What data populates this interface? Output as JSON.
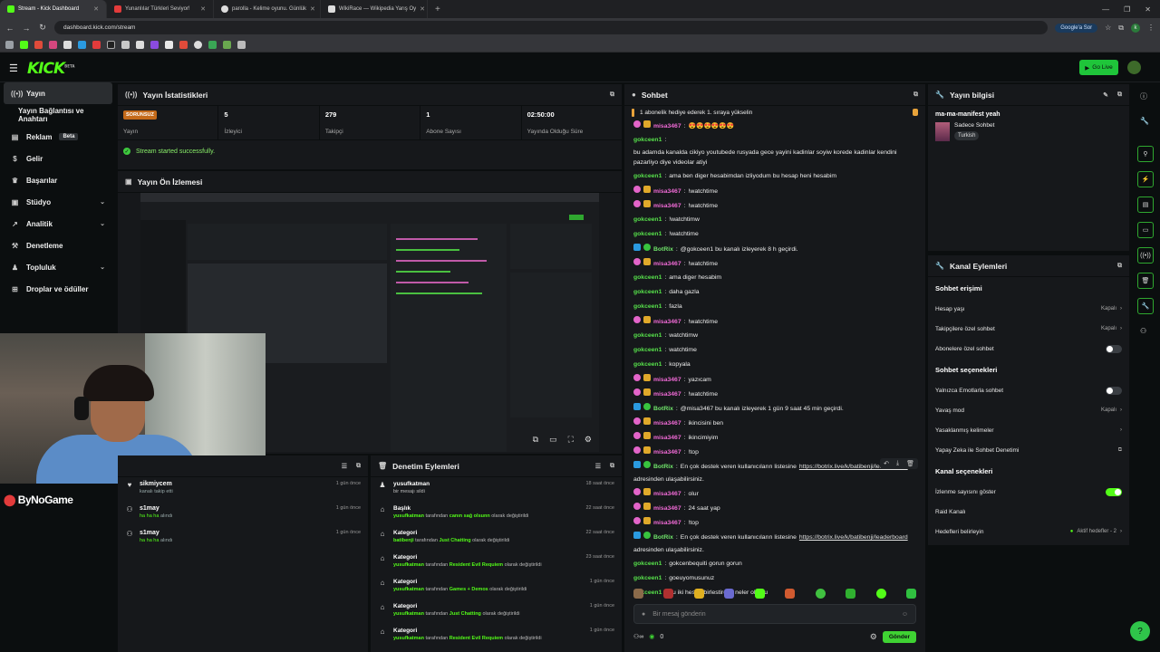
{
  "browser": {
    "tabs": [
      {
        "title": "Stream - Kick Dashboard",
        "color": "#53fc18"
      },
      {
        "title": "Yunanlılar Türkleri Seviyor!",
        "color": "#e23b3b"
      },
      {
        "title": "parolla - Kelime oyunu. Günlük",
        "color": "#dddddd"
      },
      {
        "title": "WikiRace — Wikipedia Yarış Oy",
        "color": "#dddddd"
      }
    ],
    "url": "dashboard.kick.com/stream",
    "google_label": "Google'a Sor",
    "profile_initial": "k"
  },
  "header": {
    "logo": "KICK",
    "logo_sup": "BETA",
    "go_live": "Go Live"
  },
  "sidebar": {
    "items": [
      {
        "label": "Yayın",
        "icon": "((•))",
        "chev": ""
      },
      {
        "label": "Yayın Bağlantısı ve Anahtarı",
        "icon": "",
        "chev": ""
      },
      {
        "label": "Reklam",
        "icon": "▤",
        "chev": "",
        "badge": "Beta"
      },
      {
        "label": "Gelir",
        "icon": "$",
        "chev": ""
      },
      {
        "label": "Başarılar",
        "icon": "♛",
        "chev": ""
      },
      {
        "label": "Stüdyo",
        "icon": "▣",
        "chev": "⌄"
      },
      {
        "label": "Analitik",
        "icon": "↗",
        "chev": "⌄"
      },
      {
        "label": "Denetleme",
        "icon": "⚒",
        "chev": ""
      },
      {
        "label": "Topluluk",
        "icon": "♟",
        "chev": "⌄"
      },
      {
        "label": "Droplar ve ödüller",
        "icon": "⊞",
        "chev": ""
      }
    ]
  },
  "stats": {
    "title": "Yayın İstatistikleri",
    "cells": [
      {
        "value": "SORUNSUZ",
        "label": "Yayın"
      },
      {
        "value": "5",
        "label": "İzleyici"
      },
      {
        "value": "279",
        "label": "Takipçi"
      },
      {
        "value": "1",
        "label": "Abone Sayısı"
      },
      {
        "value": "02:50:00",
        "label": "Yayında Olduğu Süre"
      }
    ],
    "message": "Stream started successfully."
  },
  "preview": {
    "title": "Yayın Ön İzlemesi"
  },
  "overlay": {
    "brand": "ByNoGame"
  },
  "activity": {
    "rows": [
      {
        "name": "sikmiycem",
        "desc": "kanalı takip etti",
        "time": "1 gün önce",
        "icon": "♥"
      },
      {
        "name": "s1may",
        "desc": "ha ha ha",
        "desc2": "alındı",
        "time": "1 gün önce",
        "icon": "⚇"
      },
      {
        "name": "s1may",
        "desc": "ha ha ha",
        "desc2": "alındı",
        "time": "1 gün önce",
        "icon": "⚇"
      }
    ]
  },
  "moderation": {
    "title": "Denetim Eylemleri",
    "rows": [
      {
        "name": "yusufkatman",
        "d1": "bir mesajı sildi",
        "d_user": "",
        "d_mid": "",
        "d_val": "",
        "d_end": "",
        "time": "18 saat önce",
        "icon": "♟"
      },
      {
        "name": "Başlık",
        "d1": "",
        "d_user": "yusufkatman",
        "d_mid": "tarafından",
        "d_val": "canın sağ olsunn",
        "d_end": "olarak değiştirildi",
        "time": "22 saat önce",
        "icon": "⌂"
      },
      {
        "name": "Kategori",
        "d1": "",
        "d_user": "batibenji",
        "d_mid": "tarafından",
        "d_val": "Just Chatting",
        "d_end": "olarak değiştirildi",
        "time": "22 saat önce",
        "icon": "⌂"
      },
      {
        "name": "Kategori",
        "d1": "",
        "d_user": "yusufkatman",
        "d_mid": "tarafından",
        "d_val": "Resident Evil Requiem",
        "d_end": "olarak değiştirildi",
        "time": "23 saat önce",
        "icon": "⌂"
      },
      {
        "name": "Kategori",
        "d1": "",
        "d_user": "yusufkatman",
        "d_mid": "tarafından",
        "d_val": "Games + Demos",
        "d_end": "olarak değiştirildi",
        "time": "1 gün önce",
        "icon": "⌂"
      },
      {
        "name": "Kategori",
        "d1": "",
        "d_user": "yusufkatman",
        "d_mid": "tarafından",
        "d_val": "Just Chatting",
        "d_end": "olarak değiştirildi",
        "time": "1 gün önce",
        "icon": "⌂"
      },
      {
        "name": "Kategori",
        "d1": "",
        "d_user": "yusufkatman",
        "d_mid": "tarafından",
        "d_val": "Resident Evil Requiem",
        "d_end": "olarak değiştirildi",
        "time": "1 gün önce",
        "icon": "⌂"
      }
    ]
  },
  "chat": {
    "title": "Sohbet",
    "pinned": "1 abonelik hediye ederek 1. sıraya yükselin",
    "messages": [
      {
        "user": "misa3467",
        "type": "misa",
        "text": "😍😍😍😍😍😍"
      },
      {
        "user": "gokceen1",
        "type": "gok",
        "text": "bu adamda kanalda cikiyo youtubede rusyada gece yayini kadinlar soyiw korede kadinlar kendini pazarliyo diye videolar atiyi"
      },
      {
        "user": "gokceen1",
        "type": "gok",
        "text": "ama ben diger hesabimdan izliyodum bu hesap heni hesabim"
      },
      {
        "user": "misa3467",
        "type": "misa",
        "text": "!watchtime"
      },
      {
        "user": "misa3467",
        "type": "misa",
        "text": "!watchtime"
      },
      {
        "user": "gokceen1",
        "type": "gok",
        "text": "!watchtimw"
      },
      {
        "user": "gokceen1",
        "type": "gok",
        "text": "!watchtime"
      },
      {
        "user": "BotRix",
        "type": "bot",
        "text": "@gokceen1 bu kanalı izleyerek 8 h geçirdi."
      },
      {
        "user": "misa3467",
        "type": "misa",
        "text": "!watchtime"
      },
      {
        "user": "gokceen1",
        "type": "gok",
        "text": "ama diger hesabim"
      },
      {
        "user": "gokceen1",
        "type": "gok",
        "text": "daha gazla"
      },
      {
        "user": "gokceen1",
        "type": "gok",
        "text": "fazla"
      },
      {
        "user": "misa3467",
        "type": "misa",
        "text": "!watchtime"
      },
      {
        "user": "gokceen1",
        "type": "gok",
        "text": "watchtimw"
      },
      {
        "user": "gokceen1",
        "type": "gok",
        "text": "watchtime"
      },
      {
        "user": "gokceen1",
        "type": "gok",
        "text": "kopyala"
      },
      {
        "user": "misa3467",
        "type": "misa",
        "text": "yazıcam"
      },
      {
        "user": "misa3467",
        "type": "misa",
        "text": "!watchtime"
      },
      {
        "user": "BotRix",
        "type": "bot",
        "text": "@misa3467 bu kanalı izleyerek 1 gün 9 saat 45 min geçirdi."
      },
      {
        "user": "misa3467",
        "type": "misa",
        "text": "ikincisini ben"
      },
      {
        "user": "misa3467",
        "type": "misa",
        "text": "ikincimiyim"
      },
      {
        "user": "misa3467",
        "type": "misa",
        "text": "!top"
      },
      {
        "user": "BotRix",
        "type": "bot",
        "text": "En çok destek veren kullanıcıların listesine",
        "link": "https://botrix.live/k/batibenji/leaderboard",
        "after": "adresinden ulaşabilirsiniz."
      },
      {
        "user": "misa3467",
        "type": "misa",
        "text": "olur"
      },
      {
        "user": "misa3467",
        "type": "misa",
        "text": "24 saat yap"
      },
      {
        "user": "misa3467",
        "type": "misa",
        "text": "!top"
      },
      {
        "user": "BotRix",
        "type": "bot",
        "text": "En çok destek veren kullanıcıların listesine",
        "link": "https://botrix.live/k/batibenji/leaderboard",
        "after": "adresinden ulaşabilirsiniz."
      },
      {
        "user": "gokceen1",
        "type": "gok",
        "text": "gokcenbequiti gorun gorun"
      },
      {
        "user": "gokceen1",
        "type": "gok",
        "text": "goeuyomusunuz"
      },
      {
        "user": "gokceen1",
        "type": "gok",
        "text": "bu iki hesap birlestirdek neler olurdu"
      }
    ],
    "input_placeholder": "Bir mesaj gönderin",
    "viewer_count": "0",
    "send_label": "Gönder"
  },
  "stream_info": {
    "title": "Yayın bilgisi",
    "stream_title": "ma-ma-manifest yeah",
    "category": "Sadece Sohbet",
    "tag": "Turkish"
  },
  "channel_actions": {
    "title": "Kanal Eylemleri",
    "sections": [
      {
        "heading": "Sohbet erişimi",
        "rows": [
          {
            "label": "Hesap yaşı",
            "value": "Kapalı",
            "kind": "chevron"
          },
          {
            "label": "Takipçilere özel sohbet",
            "value": "Kapalı",
            "kind": "chevron"
          },
          {
            "label": "Abonelere özel sohbet",
            "value": "",
            "kind": "toggle-off"
          }
        ]
      },
      {
        "heading": "Sohbet seçenekleri",
        "rows": [
          {
            "label": "Yalnızca Emotlarla sohbet",
            "value": "",
            "kind": "toggle-off"
          },
          {
            "label": "Yavaş mod",
            "value": "Kapalı",
            "kind": "chevron"
          },
          {
            "label": "Yasaklanmış kelimeler",
            "value": "",
            "kind": "chevron"
          },
          {
            "label": "Yapay Zeka ile Sohbet Denetimi",
            "value": "",
            "kind": "external"
          }
        ]
      },
      {
        "heading": "Kanal seçenekleri",
        "rows": [
          {
            "label": "İzlenme sayısını göster",
            "value": "",
            "kind": "toggle-on"
          },
          {
            "label": "Raid Kanalı",
            "value": "",
            "kind": "none"
          },
          {
            "label": "Hedefleri belirleyin",
            "value": "Aktif hedefler - 2",
            "kind": "chevron-dot"
          }
        ]
      }
    ]
  }
}
